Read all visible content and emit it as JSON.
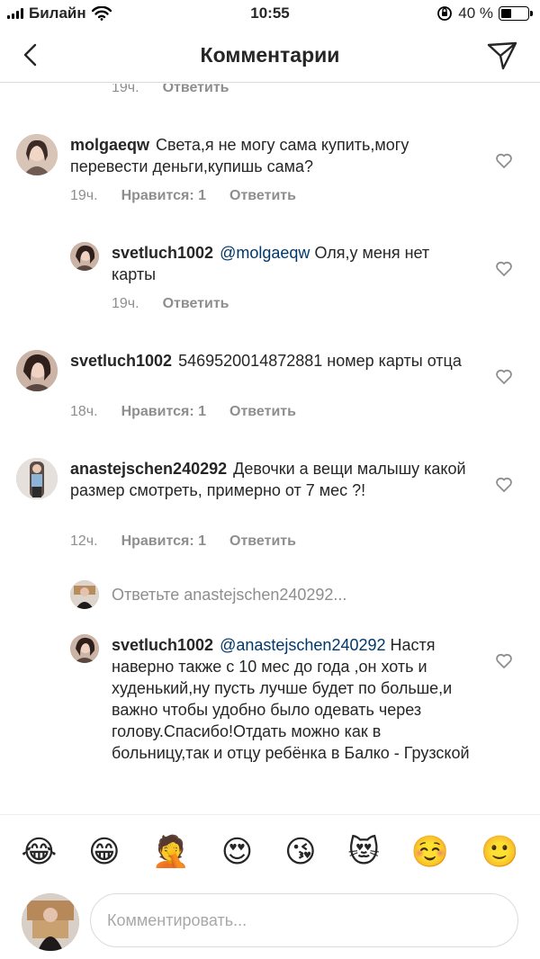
{
  "status_bar": {
    "carrier": "Билайн",
    "time": "10:55",
    "battery": "40 %",
    "battery_level": 0.4
  },
  "header": {
    "title": "Комментарии",
    "back_icon": "chevron-left-icon",
    "send_icon": "paper-plane-icon"
  },
  "labels": {
    "reply": "Ответить"
  },
  "top_partial": {
    "time": "19ч."
  },
  "comments": [
    {
      "username": "molgaeqw",
      "mention": "",
      "text": "Света,я не могу сама купить,могу перевести деньги,купишь сама?",
      "time": "19ч.",
      "likes": "Нравится: 1"
    },
    {
      "username": "svetluch1002",
      "mention": "@molgaeqw",
      "text": "Оля,у меня нет карты",
      "time": "19ч.",
      "likes": ""
    },
    {
      "username": "svetluch1002",
      "mention": "",
      "text": "5469520014872881 номер карты отца",
      "time": "18ч.",
      "likes": "Нравится: 1"
    },
    {
      "username": "anastejschen240292",
      "mention": "",
      "text": "Девочки а вещи малышу какой размер смотреть, примерно от 7 мес ?!",
      "time": "12ч.",
      "likes": "Нравится: 1"
    },
    {
      "username": "svetluch1002",
      "mention": "@anastejschen240292",
      "text": "Настя наверно также с 10 мес до года ,он хоть и худенький,ну пусть лучше будет по больше,и важно чтобы удобно было одевать через голову.Спасибо!Отдать можно как в больницу,так и отцу ребёнка в Балко - Грузской",
      "time": "",
      "likes": ""
    }
  ],
  "reply_prompt": "Ответьте anastejschen240292...",
  "emoji_bar": [
    "😂",
    "😁",
    "🤦",
    "😍",
    "😘",
    "😻",
    "☺️",
    "🙂"
  ],
  "input": {
    "placeholder": "Комментировать..."
  }
}
